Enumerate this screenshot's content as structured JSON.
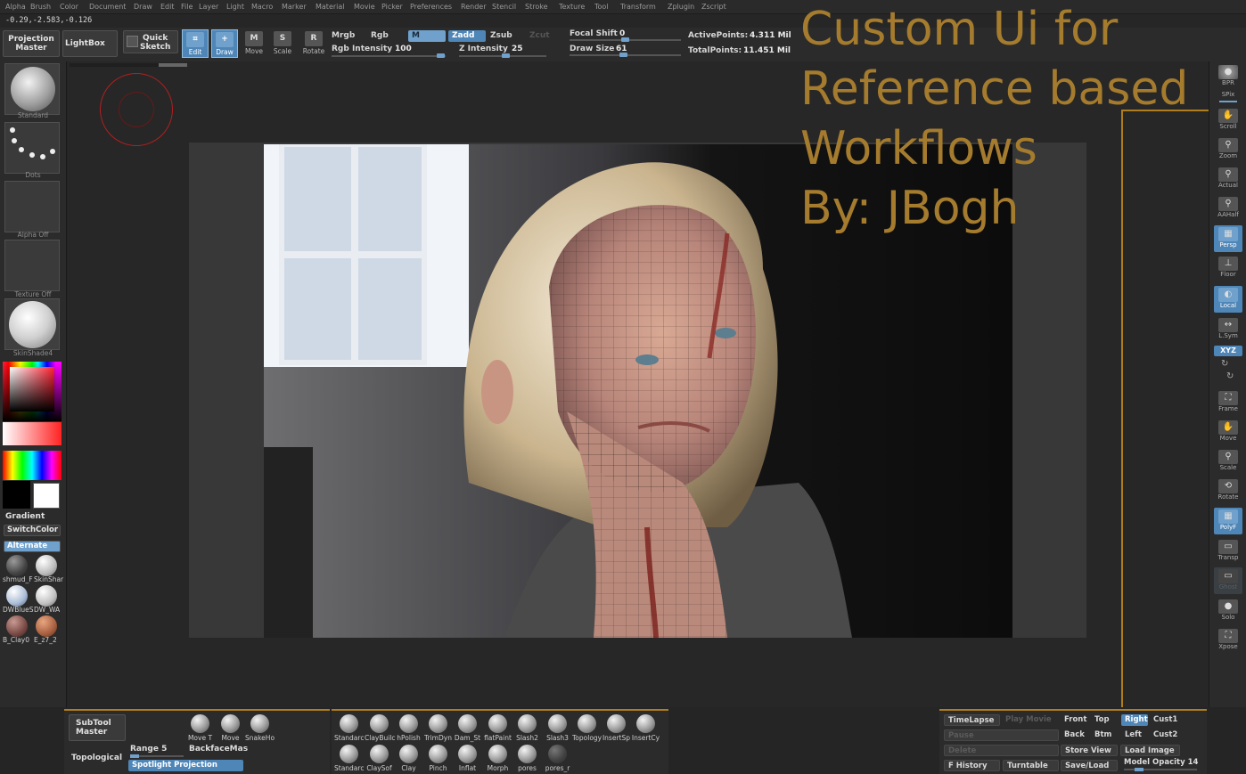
{
  "menu": [
    "Alpha",
    "Brush",
    "Color",
    "Document",
    "Draw",
    "Edit",
    "File",
    "Layer",
    "Light",
    "Macro",
    "Marker",
    "Material",
    "Movie",
    "Picker",
    "Preferences",
    "Render",
    "Stencil",
    "Stroke",
    "Texture",
    "Tool",
    "Transform",
    "Zplugin",
    "Zscript"
  ],
  "coords": "-0.29,-2.583,-0.126",
  "toolbar": {
    "projection_master": [
      "Projection",
      "Master"
    ],
    "lightbox": "LightBox",
    "quick_sketch": [
      "Quick",
      "Sketch"
    ],
    "edit": "Edit",
    "draw": "Draw",
    "move": "Move",
    "scale": "Scale",
    "rotate": "Rotate",
    "mrgb": "Mrgb",
    "rgb": "Rgb",
    "m": "M",
    "zadd": "Zadd",
    "zsub": "Zsub",
    "zcut": "Zcut",
    "rgb_intensity_label": "Rgb Intensity",
    "rgb_intensity_value": "100",
    "z_intensity_label": "Z Intensity",
    "z_intensity_value": "25",
    "focal_shift_label": "Focal Shift",
    "focal_shift_value": "0",
    "draw_size_label": "Draw Size",
    "draw_size_value": "61",
    "active_points_label": "ActivePoints:",
    "active_points_value": "4.311 Mil",
    "total_points_label": "TotalPoints:",
    "total_points_value": "11.451 Mil"
  },
  "left_tray": {
    "brush_caption": "Standard",
    "stroke_caption": "Dots",
    "alpha_caption": "Alpha Off",
    "texture_caption": "Texture Off",
    "material_caption": "SkinShade4",
    "gradient": "Gradient",
    "switch_color": "SwitchColor",
    "alternate": "Alternate",
    "materials": [
      {
        "caption": "shmud_F",
        "color": "#5c5c5c"
      },
      {
        "caption": "SkinShar",
        "color": "#e6e6e6"
      },
      {
        "caption": "DWBlueS",
        "color": "#c9d6e6"
      },
      {
        "caption": "DW_WA",
        "color": "#d8d8d8"
      },
      {
        "caption": "B_Clay0",
        "color": "#8a5a55"
      },
      {
        "caption": "E_z7_2",
        "color": "#b07050"
      }
    ]
  },
  "right_tray": [
    {
      "label": "BPR",
      "icon": "bpr-icon",
      "on": false
    },
    {
      "label": "SPix",
      "icon": "spix-icon",
      "on": false
    },
    {
      "label": "Scroll",
      "icon": "scroll-hand-icon",
      "on": false
    },
    {
      "label": "Zoom",
      "icon": "zoom-icon",
      "on": false
    },
    {
      "label": "Actual",
      "icon": "actual-size-icon",
      "on": false
    },
    {
      "label": "AAHalf",
      "icon": "aahalf-icon",
      "on": false
    },
    {
      "label": "Persp",
      "icon": "perspective-icon",
      "on": true
    },
    {
      "label": "Floor",
      "icon": "floor-icon",
      "on": false
    },
    {
      "label": "Local",
      "icon": "local-icon",
      "on": true
    },
    {
      "label": "L.Sym",
      "icon": "lsym-icon",
      "on": false
    },
    {
      "label": "XYZ",
      "icon": "xyz-icon",
      "on": true
    },
    {
      "label": "Frame",
      "icon": "frame-icon",
      "on": false
    },
    {
      "label": "Move",
      "icon": "move-hand-icon",
      "on": false
    },
    {
      "label": "Scale",
      "icon": "scale-icon",
      "on": false
    },
    {
      "label": "Rotate",
      "icon": "rotate-icon",
      "on": false
    },
    {
      "label": "PolyF",
      "icon": "polyframe-icon",
      "on": true
    },
    {
      "label": "Transp",
      "icon": "transparency-icon",
      "on": false
    },
    {
      "label": "Ghost",
      "icon": "ghost-icon",
      "on": false
    },
    {
      "label": "Solo",
      "icon": "solo-icon",
      "on": false
    },
    {
      "label": "Xpose",
      "icon": "xpose-icon",
      "on": false
    }
  ],
  "overlay_title": [
    "Custom Ui for",
    "Reference based",
    "Workflows",
    "By: JBogh"
  ],
  "bottom": {
    "subtool_master": [
      "SubTool",
      "Master"
    ],
    "topological": "Topological",
    "range_label": "Range",
    "range_value": "5",
    "backface": "BackfaceMas",
    "spotlight": "Spotlight Projection",
    "transform_brushes": [
      "Move T",
      "Move",
      "SnakeHo"
    ],
    "brushes_row1": [
      "Standarc",
      "ClayBuilc",
      "hPolish",
      "TrimDyn",
      "Dam_St",
      "flatPaint",
      "Slash2",
      "Slash3",
      "Topology",
      "InsertSp",
      "InsertCy"
    ],
    "brushes_row2": [
      "Standarc",
      "ClaySof",
      "Clay",
      "Pinch",
      "Inflat",
      "Morph",
      "pores",
      "pores_r"
    ],
    "timelapse": "TimeLapse",
    "play_movie": "Play Movie",
    "pause": "Pause",
    "delete": "Delete",
    "f_history": "F History",
    "turntable": "Turntable",
    "views": [
      "Front",
      "Top",
      "Right",
      "Cust1",
      "Back",
      "Btm",
      "Left",
      "Cust2"
    ],
    "store_view": "Store View",
    "load_image": "Load Image",
    "save_load": "Save/Load",
    "model_opacity_label": "Model Opacity",
    "model_opacity_value": "14"
  },
  "colors": {
    "accent": "#4f86b8",
    "overlay_text": "#a57b2e",
    "frame_line": "#b07e1c"
  }
}
